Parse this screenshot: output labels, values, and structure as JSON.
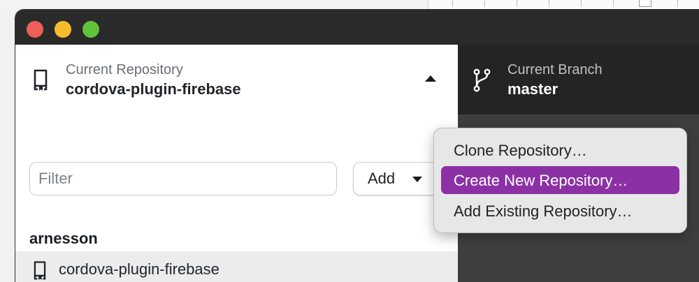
{
  "window": {
    "traffic_lights": {
      "close_color": "#ee5f57",
      "minimize_color": "#f6bc2f",
      "zoom_color": "#5fc33b"
    }
  },
  "repository_picker": {
    "caption": "Current Repository",
    "name": "cordova-plugin-firebase",
    "icon": "repo-icon",
    "toggle_icon": "caret-up-icon"
  },
  "branch_picker": {
    "caption": "Current Branch",
    "name": "master",
    "icon": "git-branch-icon"
  },
  "filter": {
    "placeholder": "Filter",
    "value": ""
  },
  "add_button": {
    "label": "Add",
    "icon": "caret-down-icon"
  },
  "repository_list": {
    "groups": [
      {
        "label": "arnesson",
        "items": [
          {
            "label": "cordova-plugin-firebase",
            "icon": "repo-icon"
          }
        ]
      }
    ]
  },
  "add_menu": {
    "items": [
      {
        "label": "Clone Repository…"
      },
      {
        "label": "Create New Repository…",
        "selected": true
      },
      {
        "label": "Add Existing Repository…"
      }
    ],
    "highlight_color": "#8c31a5"
  }
}
